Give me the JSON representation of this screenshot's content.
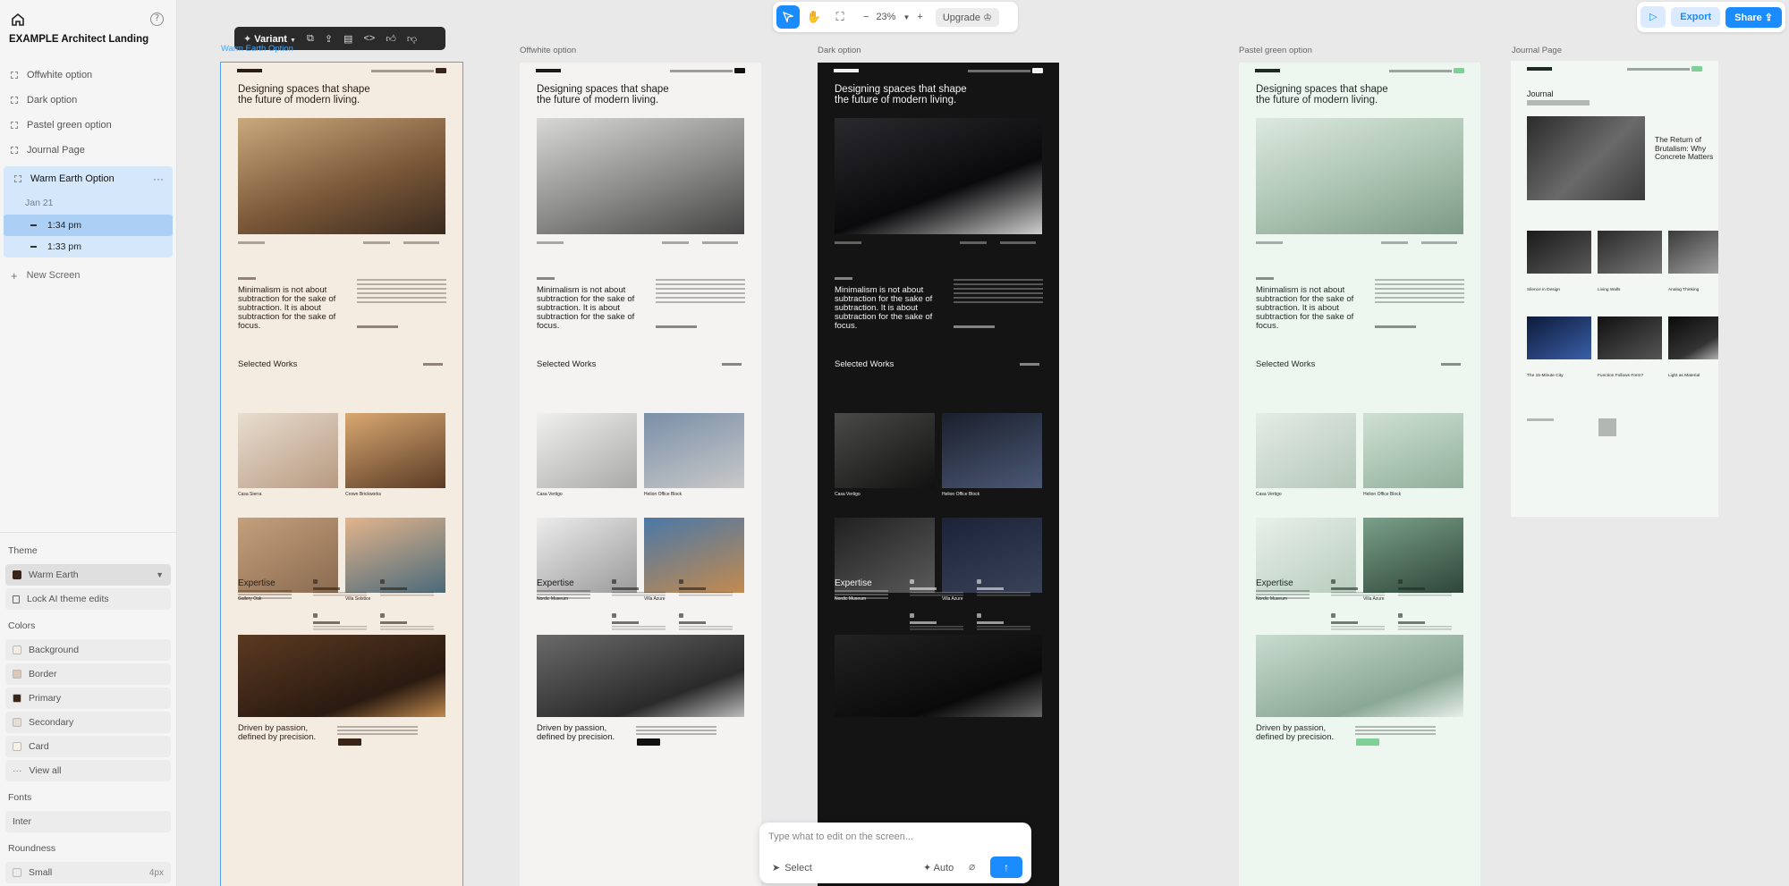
{
  "project": {
    "title": "EXAMPLE Architect Landing"
  },
  "screens": [
    {
      "label": "Offwhite option"
    },
    {
      "label": "Dark option"
    },
    {
      "label": "Pastel green option"
    },
    {
      "label": "Journal Page"
    }
  ],
  "active_screen": {
    "label": "Warm Earth Option",
    "date": "Jan 21",
    "versions": [
      "1:34 pm",
      "1:33 pm"
    ]
  },
  "new_screen_label": "New Screen",
  "theme": {
    "section_label": "Theme",
    "selected": "Warm Earth",
    "lock_label": "Lock AI theme edits"
  },
  "colors": {
    "section_label": "Colors",
    "items": [
      {
        "label": "Background",
        "swatch": "#f3ece4"
      },
      {
        "label": "Border",
        "swatch": "#d9c8b6"
      },
      {
        "label": "Primary",
        "swatch": "#3a2418"
      },
      {
        "label": "Secondary",
        "swatch": "#e8ddd2"
      },
      {
        "label": "Card",
        "swatch": "#f7f1ea"
      }
    ],
    "view_all_label": "View all"
  },
  "fonts": {
    "section_label": "Fonts",
    "value": "Inter"
  },
  "roundness": {
    "section_label": "Roundness",
    "value": "Small",
    "amount": "4px"
  },
  "toolbar": {
    "zoom": "23%",
    "upgrade_label": "Upgrade",
    "export_label": "Export",
    "share_label": "Share"
  },
  "variant_bar": {
    "label": "Variant"
  },
  "frames": [
    {
      "label": "Warm Earth Option",
      "bg": "#f4ebe1",
      "fg": "#2b1d14",
      "accent": "#3a2418",
      "hero_title": "Designing spaces that shape the future of modern living.",
      "quote": "Minimalism is not about subtraction for the sake of subtraction. It is about subtraction for the sake of focus.",
      "section_works": "Selected Works",
      "works": [
        "Casa Sierra",
        "Crown Brickworks",
        "Gallery Oak",
        "Villa Solstice"
      ],
      "expertise": "Expertise",
      "driven": "Driven by passion, defined by precision."
    },
    {
      "label": "Offwhite option",
      "bg": "#f4f3f1",
      "fg": "#1b1b1b",
      "accent": "#111111",
      "hero_title": "Designing spaces that shape the future of modern living.",
      "quote": "Minimalism is not about subtraction for the sake of subtraction. It is about subtraction for the sake of focus.",
      "section_works": "Selected Works",
      "works": [
        "Casa Vertigo",
        "Helion Office Block",
        "Nordic Museum",
        "Villa Azure"
      ],
      "expertise": "Expertise",
      "driven": "Driven by passion, defined by precision."
    },
    {
      "label": "Dark option",
      "bg": "#141414",
      "fg": "#f2f2f2",
      "accent": "#f2f2f2",
      "hero_title": "Designing spaces that shape the future of modern living.",
      "quote": "Minimalism is not about subtraction for the sake of subtraction. It is about subtraction for the sake of focus.",
      "section_works": "Selected Works",
      "works": [
        "Casa Vertigo",
        "Helion Office Block",
        "Nordic Museum",
        "Villa Azure"
      ],
      "expertise": "Expertise",
      "driven": ""
    },
    {
      "label": "Pastel green option",
      "bg": "#eef6f0",
      "fg": "#1d2a22",
      "accent": "#7fcf98",
      "hero_title": "Designing spaces that shape the future of modern living.",
      "quote": "Minimalism is not about subtraction for the sake of subtraction. It is about subtraction for the sake of focus.",
      "section_works": "Selected Works",
      "works": [
        "Casa Vertigo",
        "Helion Office Block",
        "Nordic Museum",
        "Villa Azure"
      ],
      "expertise": "Expertise",
      "driven": "Driven by passion, defined by precision."
    }
  ],
  "journal": {
    "label": "Journal Page",
    "title": "Journal",
    "feature_headline": "The Return of Brutalism: Why Concrete Matters",
    "articles": [
      "Silence in Design",
      "Living Walls",
      "Analog Thinking",
      "The 15-Minute City",
      "Function Follows Form?",
      "Light as Material"
    ]
  },
  "prompt": {
    "placeholder": "Type what to edit on the screen...",
    "select_label": "Select",
    "auto_label": "Auto"
  }
}
